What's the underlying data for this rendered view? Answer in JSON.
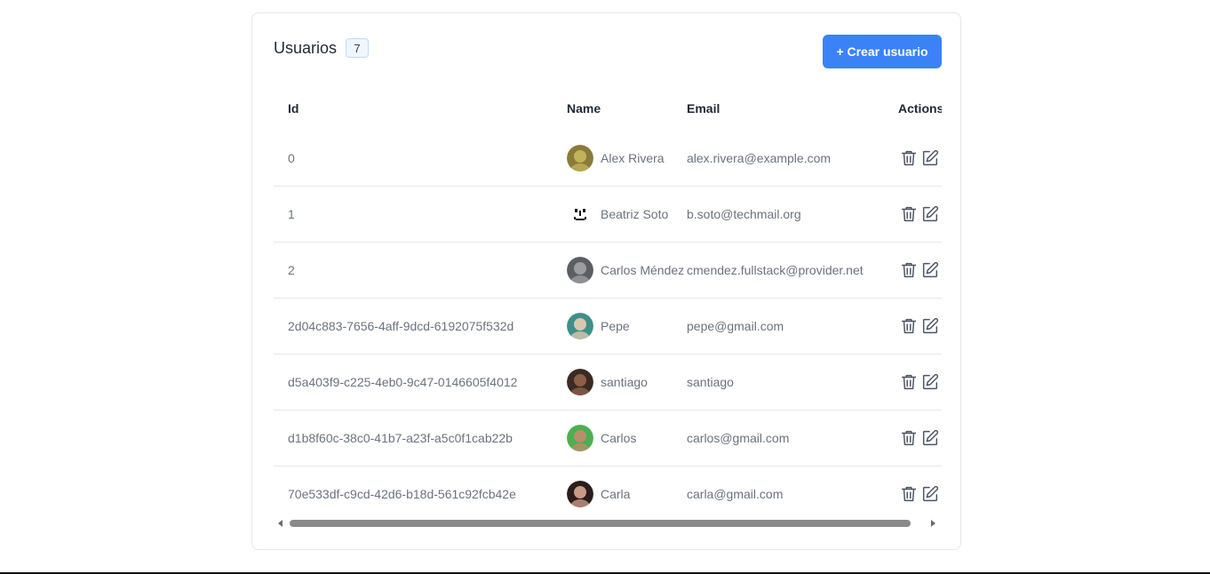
{
  "panel": {
    "title": "Usuarios",
    "count": "7",
    "create_label": "+ Crear usuario"
  },
  "table": {
    "headers": {
      "id": "Id",
      "name": "Name",
      "email": "Email",
      "actions": "Actions"
    },
    "rows": [
      {
        "id": "0",
        "name": "Alex Rivera",
        "email": "alex.rivera@example.com",
        "avatar": "photo-avatar"
      },
      {
        "id": "1",
        "name": "Beatriz Soto",
        "email": "b.soto@techmail.org",
        "avatar": "smiley-avatar"
      },
      {
        "id": "2",
        "name": "Carlos Méndez",
        "email": "cmendez.fullstack@provider.net",
        "avatar": "photo-avatar"
      },
      {
        "id": "2d04c883-7656-4aff-9dcd-6192075f532d",
        "name": "Pepe",
        "email": "pepe@gmail.com",
        "avatar": "photo-avatar"
      },
      {
        "id": "d5a403f9-c225-4eb0-9c47-0146605f4012",
        "name": "santiago",
        "email": "santiago",
        "avatar": "photo-avatar"
      },
      {
        "id": "d1b8f60c-38c0-41b7-a23f-a5c0f1cab22b",
        "name": "Carlos",
        "email": "carlos@gmail.com",
        "avatar": "photo-avatar"
      },
      {
        "id": "70e533df-c9cd-42d6-b18d-561c92fcb42e",
        "name": "Carla",
        "email": "carla@gmail.com",
        "avatar": "photo-avatar"
      }
    ],
    "row_actions": [
      "trash-icon",
      "edit-icon"
    ]
  },
  "colors": {
    "accent": "#3b82f6",
    "badge_bg": "#eff6ff",
    "text_muted": "#6b7280",
    "border": "#e5e7eb"
  }
}
